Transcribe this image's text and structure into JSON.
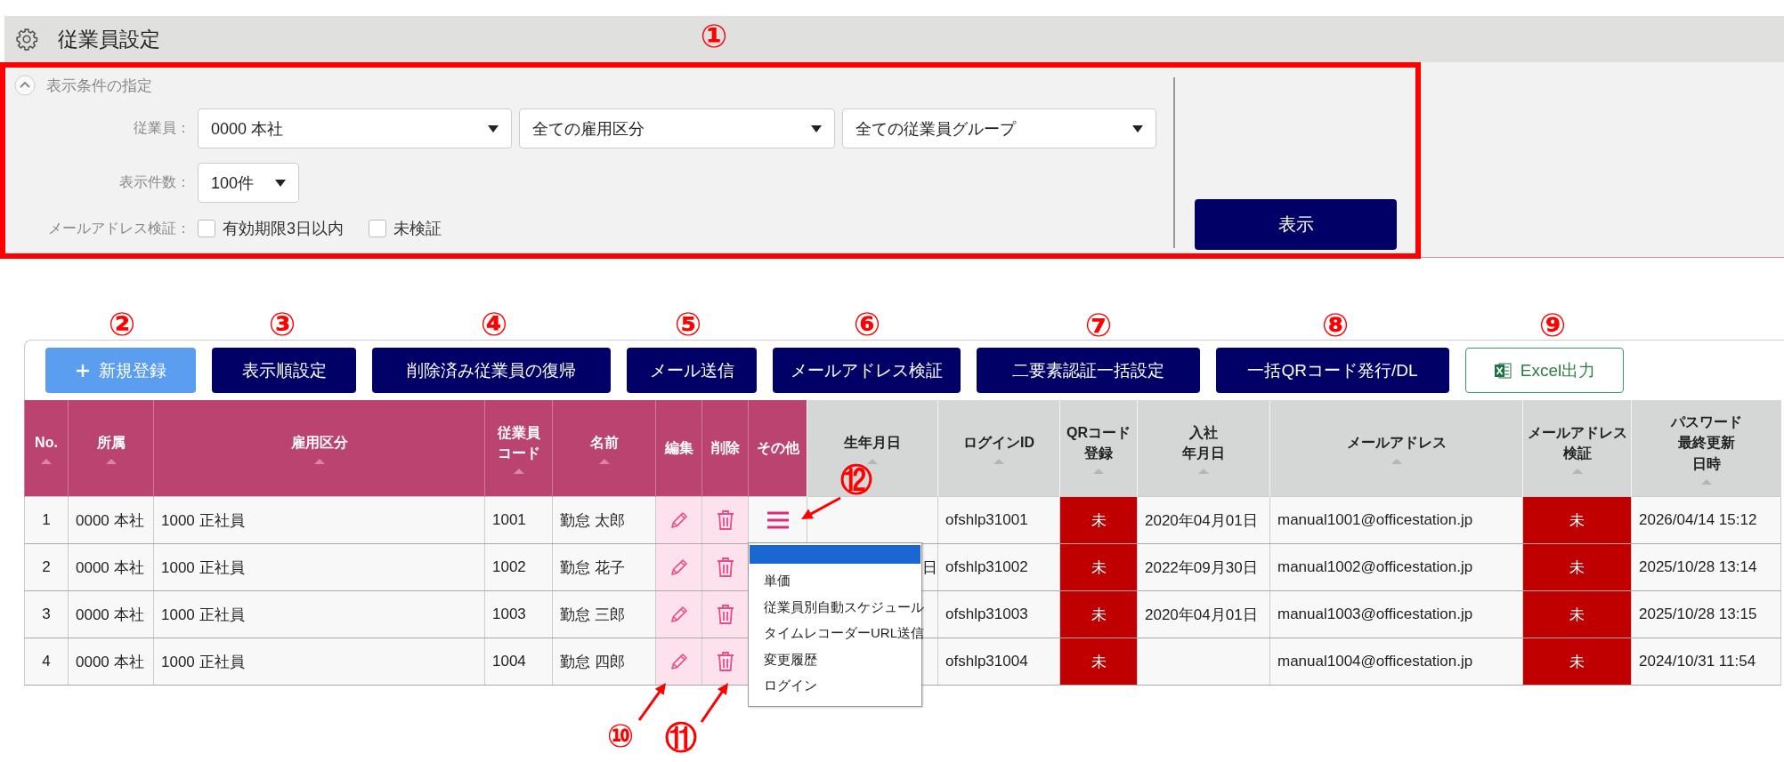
{
  "page": {
    "title": "従業員設定"
  },
  "filter": {
    "heading": "表示条件の指定",
    "expanded": true,
    "employee_label": "従業員：",
    "employee_selects": [
      "0000 本社",
      "全ての雇用区分",
      "全ての従業員グループ"
    ],
    "count_label": "表示件数：",
    "count_select": "100件",
    "email_label": "メールアドレス検証：",
    "checkboxes": [
      {
        "label": "有効期限3日以内",
        "checked": false
      },
      {
        "label": "未検証",
        "checked": false
      }
    ],
    "submit": "表示"
  },
  "toolbar": [
    {
      "label": "新規登録",
      "kind": "add"
    },
    {
      "label": "表示順設定",
      "kind": "primary"
    },
    {
      "label": "削除済み従業員の復帰",
      "kind": "primary"
    },
    {
      "label": "メール送信",
      "kind": "primary"
    },
    {
      "label": "メールアドレス検証",
      "kind": "primary"
    },
    {
      "label": "二要素認証一括設定",
      "kind": "primary"
    },
    {
      "label": "一括QRコード発行/DL",
      "kind": "primary"
    },
    {
      "label": "Excel出力",
      "kind": "excel"
    }
  ],
  "table": {
    "columns": [
      {
        "label": "No.",
        "kind": "number",
        "highlighted": true,
        "sortable": true
      },
      {
        "label": "所属",
        "kind": "text",
        "highlighted": true,
        "sortable": true
      },
      {
        "label": "雇用区分",
        "kind": "text",
        "highlighted": true,
        "sortable": true
      },
      {
        "label": [
          "従業員",
          "コード"
        ],
        "kind": "text",
        "highlighted": true,
        "sortable": true
      },
      {
        "label": "名前",
        "kind": "text",
        "highlighted": true,
        "sortable": true
      },
      {
        "label": "編集",
        "kind": "edit",
        "highlighted": true,
        "sortable": false
      },
      {
        "label": "削除",
        "kind": "delete",
        "highlighted": true,
        "sortable": false
      },
      {
        "label": "その他",
        "kind": "other",
        "highlighted": true,
        "sortable": false
      },
      {
        "label": "生年月日",
        "kind": "text",
        "highlighted": false,
        "sortable": true
      },
      {
        "label": "ログインID",
        "kind": "text",
        "highlighted": false,
        "sortable": true
      },
      {
        "label": [
          "QRコード",
          "登録"
        ],
        "kind": "status",
        "highlighted": false,
        "sortable": true
      },
      {
        "label": [
          "入社",
          "年月日"
        ],
        "kind": "text",
        "highlighted": false,
        "sortable": true
      },
      {
        "label": "メールアドレス",
        "kind": "text",
        "highlighted": false,
        "sortable": true
      },
      {
        "label": [
          "メールアドレス",
          "検証"
        ],
        "kind": "status",
        "highlighted": false,
        "sortable": true
      },
      {
        "label": [
          "パスワード",
          "最終更新",
          "日時"
        ],
        "kind": "text",
        "highlighted": false,
        "sortable": true
      }
    ],
    "rows": [
      {
        "cells": [
          "1",
          "0000 本社",
          "1000 正社員",
          "1001",
          "勤怠 太郎",
          "",
          "",
          "",
          "",
          "ofshlp31001",
          "未",
          "2020年04月01日",
          "manual1001@officestation.jp",
          "未",
          "2026/04/14 15:12"
        ],
        "edit": true,
        "delete": true,
        "menu_open": true
      },
      {
        "cells": [
          "2",
          "0000 本社",
          "1000 正社員",
          "1002",
          "勤怠 花子",
          "",
          "",
          "",
          "日",
          "ofshlp31002",
          "未",
          "2022年09月30日",
          "manual1002@officestation.jp",
          "未",
          "2025/10/28 13:14"
        ],
        "edit": true,
        "delete": true
      },
      {
        "cells": [
          "3",
          "0000 本社",
          "1000 正社員",
          "1003",
          "勤怠 三郎",
          "",
          "",
          "",
          "",
          "ofshlp31003",
          "未",
          "2020年04月01日",
          "manual1003@officestation.jp",
          "未",
          "2025/10/28 13:15"
        ],
        "edit": true,
        "delete": true
      },
      {
        "cells": [
          "4",
          "0000 本社",
          "1000 正社員",
          "1004",
          "勤怠 四郎",
          "",
          "",
          "",
          "",
          "ofshlp31004",
          "未",
          "",
          "manual1004@officestation.jp",
          "未",
          "2024/10/31 11:54"
        ],
        "edit": true,
        "delete": true
      }
    ]
  },
  "menu": {
    "items": [
      "単価",
      "従業員別自動スケジュール",
      "タイムレコーダーURL送信",
      "変更履歴",
      "ログイン"
    ]
  },
  "annotations": [
    {
      "label": "①"
    },
    {
      "label": "②"
    },
    {
      "label": "③"
    },
    {
      "label": "④"
    },
    {
      "label": "⑤"
    },
    {
      "label": "⑥"
    },
    {
      "label": "⑦"
    },
    {
      "label": "⑧"
    },
    {
      "label": "⑨"
    },
    {
      "label": "⑩",
      "arrow": true
    },
    {
      "label": "⑪",
      "arrow": true
    },
    {
      "label": "⑫",
      "arrow": true
    }
  ]
}
